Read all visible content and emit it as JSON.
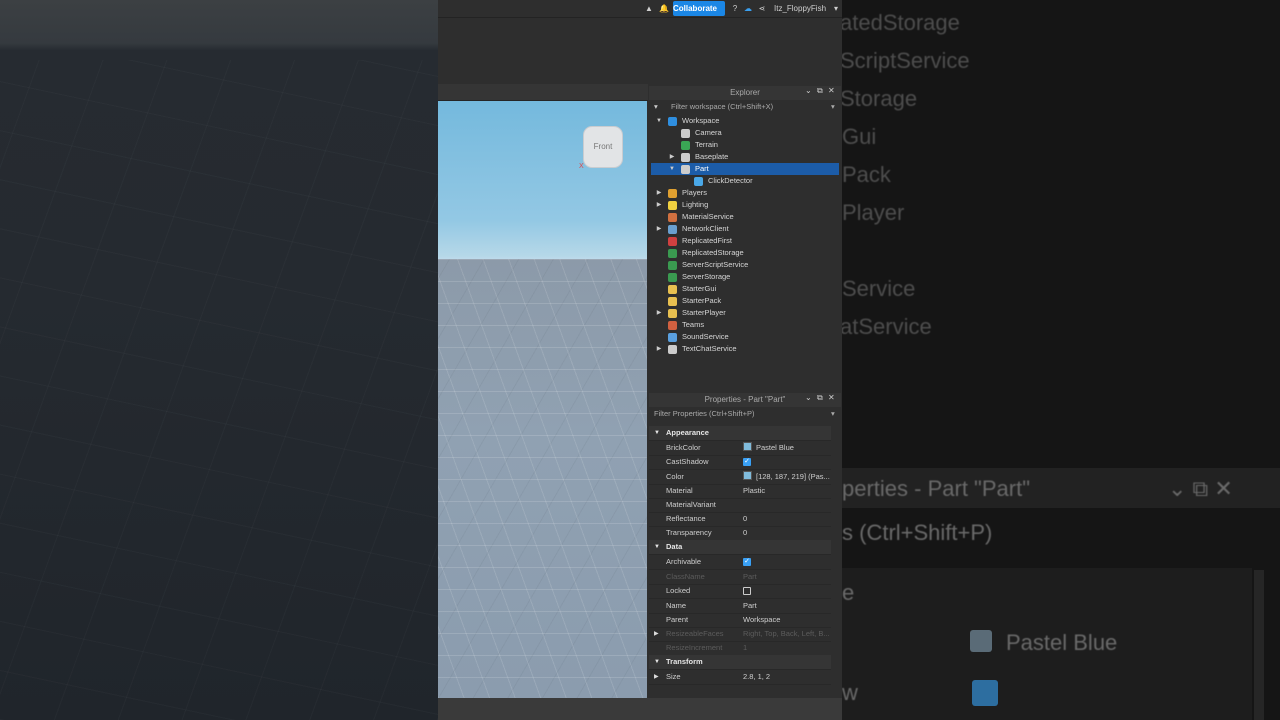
{
  "topbar": {
    "collaborate": "Collaborate",
    "username": "Itz_FloppyFish"
  },
  "viewport": {
    "viewcube_label": "Front",
    "axis_x": "X"
  },
  "explorer": {
    "title": "Explorer",
    "filter": "Filter workspace (Ctrl+Shift+X)",
    "items": [
      {
        "label": "Workspace",
        "indent": 0,
        "arrow": "▼",
        "color": "#2f8fe0"
      },
      {
        "label": "Camera",
        "indent": 1,
        "arrow": "",
        "color": "#cccccc"
      },
      {
        "label": "Terrain",
        "indent": 1,
        "arrow": "",
        "color": "#3aa655"
      },
      {
        "label": "Baseplate",
        "indent": 1,
        "arrow": "▶",
        "color": "#cccccc"
      },
      {
        "label": "Part",
        "indent": 1,
        "arrow": "▼",
        "color": "#cccccc",
        "selected": true
      },
      {
        "label": "ClickDetector",
        "indent": 2,
        "arrow": "",
        "color": "#4aa8e8"
      },
      {
        "label": "Players",
        "indent": 0,
        "arrow": "▶",
        "color": "#e0a030"
      },
      {
        "label": "Lighting",
        "indent": 0,
        "arrow": "▶",
        "color": "#f0d040"
      },
      {
        "label": "MaterialService",
        "indent": 0,
        "arrow": "",
        "color": "#d07040"
      },
      {
        "label": "NetworkClient",
        "indent": 0,
        "arrow": "▶",
        "color": "#6aa0d0"
      },
      {
        "label": "ReplicatedFirst",
        "indent": 0,
        "arrow": "",
        "color": "#d04040"
      },
      {
        "label": "ReplicatedStorage",
        "indent": 0,
        "arrow": "",
        "color": "#3a9a50"
      },
      {
        "label": "ServerScriptService",
        "indent": 0,
        "arrow": "",
        "color": "#3a9a50"
      },
      {
        "label": "ServerStorage",
        "indent": 0,
        "arrow": "",
        "color": "#3a9a50"
      },
      {
        "label": "StarterGui",
        "indent": 0,
        "arrow": "",
        "color": "#e8c050"
      },
      {
        "label": "StarterPack",
        "indent": 0,
        "arrow": "",
        "color": "#e8c050"
      },
      {
        "label": "StarterPlayer",
        "indent": 0,
        "arrow": "▶",
        "color": "#e8c050"
      },
      {
        "label": "Teams",
        "indent": 0,
        "arrow": "",
        "color": "#d06040"
      },
      {
        "label": "SoundService",
        "indent": 0,
        "arrow": "",
        "color": "#5aa0e0"
      },
      {
        "label": "TextChatService",
        "indent": 0,
        "arrow": "▶",
        "color": "#cccccc"
      }
    ]
  },
  "properties": {
    "title": "Properties - Part \"Part\"",
    "filter": "Filter Properties (Ctrl+Shift+P)",
    "rows": [
      {
        "kind": "cat",
        "name": "Appearance"
      },
      {
        "kind": "prop",
        "name": "BrickColor",
        "value": "Pastel Blue",
        "swatch": true
      },
      {
        "kind": "check",
        "name": "CastShadow",
        "checked": true
      },
      {
        "kind": "prop",
        "name": "Color",
        "value": "[128, 187, 219] (Pas...",
        "swatch": true
      },
      {
        "kind": "prop",
        "name": "Material",
        "value": "Plastic"
      },
      {
        "kind": "prop",
        "name": "MaterialVariant",
        "value": ""
      },
      {
        "kind": "prop",
        "name": "Reflectance",
        "value": "0"
      },
      {
        "kind": "prop",
        "name": "Transparency",
        "value": "0"
      },
      {
        "kind": "cat",
        "name": "Data"
      },
      {
        "kind": "check",
        "name": "Archivable",
        "checked": true
      },
      {
        "kind": "prop",
        "name": "ClassName",
        "value": "Part",
        "disabled": true
      },
      {
        "kind": "check",
        "name": "Locked",
        "checked": false
      },
      {
        "kind": "prop",
        "name": "Name",
        "value": "Part"
      },
      {
        "kind": "prop",
        "name": "Parent",
        "value": "Workspace"
      },
      {
        "kind": "prop",
        "name": "ResizeableFaces",
        "value": "Right, Top, Back, Left, B...",
        "disabled": true,
        "arrow": true
      },
      {
        "kind": "prop",
        "name": "ResizeIncrement",
        "value": "1",
        "disabled": true
      },
      {
        "kind": "cat",
        "name": "Transform"
      },
      {
        "kind": "prop",
        "name": "Size",
        "value": "2.8, 1, 2",
        "arrow": true
      }
    ]
  },
  "bg_right": {
    "lines": [
      "atedStorage",
      "ScriptService",
      "Storage",
      "Gui",
      "Pack",
      "Player",
      "Service",
      "atService"
    ],
    "props_title": "perties - Part \"Part\"",
    "filter": "s (Ctrl+Shift+P)",
    "e_fragment": "e",
    "swatch_label": "Pastel Blue",
    "w_fragment": "w"
  }
}
